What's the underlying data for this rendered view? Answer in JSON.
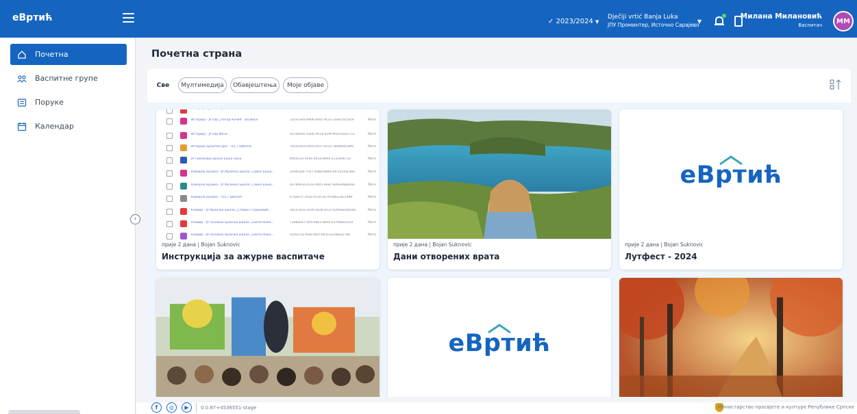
{
  "header": {
    "logo": "еВртић",
    "year": "2023/2024",
    "school_name": "Dječiji vrtić Banja Luka",
    "school_sub": "ЈПУ Проминтер, Источно Сарајево",
    "user_name": "Милана Милановић",
    "user_role": "Васпитач",
    "avatar_initials": "ММ",
    "accent": "#1565c0",
    "avatar_color": "#b04ab8",
    "icons": [
      "menu-icon",
      "check-icon",
      "chevron-down-icon",
      "bell-icon",
      "office-icon"
    ]
  },
  "sidebar": {
    "items": [
      {
        "label": "Почетна",
        "icon": "home-icon",
        "active": true
      },
      {
        "label": "Васпитне групе",
        "icon": "groups-icon",
        "active": false
      },
      {
        "label": "Поруке",
        "icon": "messages-icon",
        "active": false
      },
      {
        "label": "Календар",
        "icon": "calendar-icon",
        "active": false
      }
    ]
  },
  "main": {
    "title": "Почетна страна",
    "filters": [
      {
        "label": "Све",
        "active": true
      },
      {
        "label": "Мултимедија",
        "active": false
      },
      {
        "label": "Обавјештења",
        "active": false
      },
      {
        "label": "Моје објаве",
        "active": false
      }
    ],
    "cards": [
      {
        "meta": "прије 2 дана | Bojan Suknovic",
        "title": "Инструкција за ажурне васпитаче",
        "media": "table-screenshot"
      },
      {
        "meta": "прије 2 дана | Bojan Suknovic",
        "title": "Дани отворених врата",
        "media": "lake-photo"
      },
      {
        "meta": "прије 2 дана | Bojan Suknovic",
        "title": "Лутфест - 2024",
        "media": "logo"
      },
      {
        "meta": "",
        "title": "",
        "media": "puppet-show-photo"
      },
      {
        "meta": "",
        "title": "",
        "media": "logo"
      },
      {
        "meta": "",
        "title": "",
        "media": "autumn-forest-photo"
      }
    ],
    "card_logo_text": "еВртић"
  },
  "footer": {
    "version": "0.0.87+4536551-stage",
    "ministry": "Министарство просвјете и културе Републике Српске",
    "social": [
      "facebook-icon",
      "instagram-icon",
      "youtube-icon"
    ]
  }
}
